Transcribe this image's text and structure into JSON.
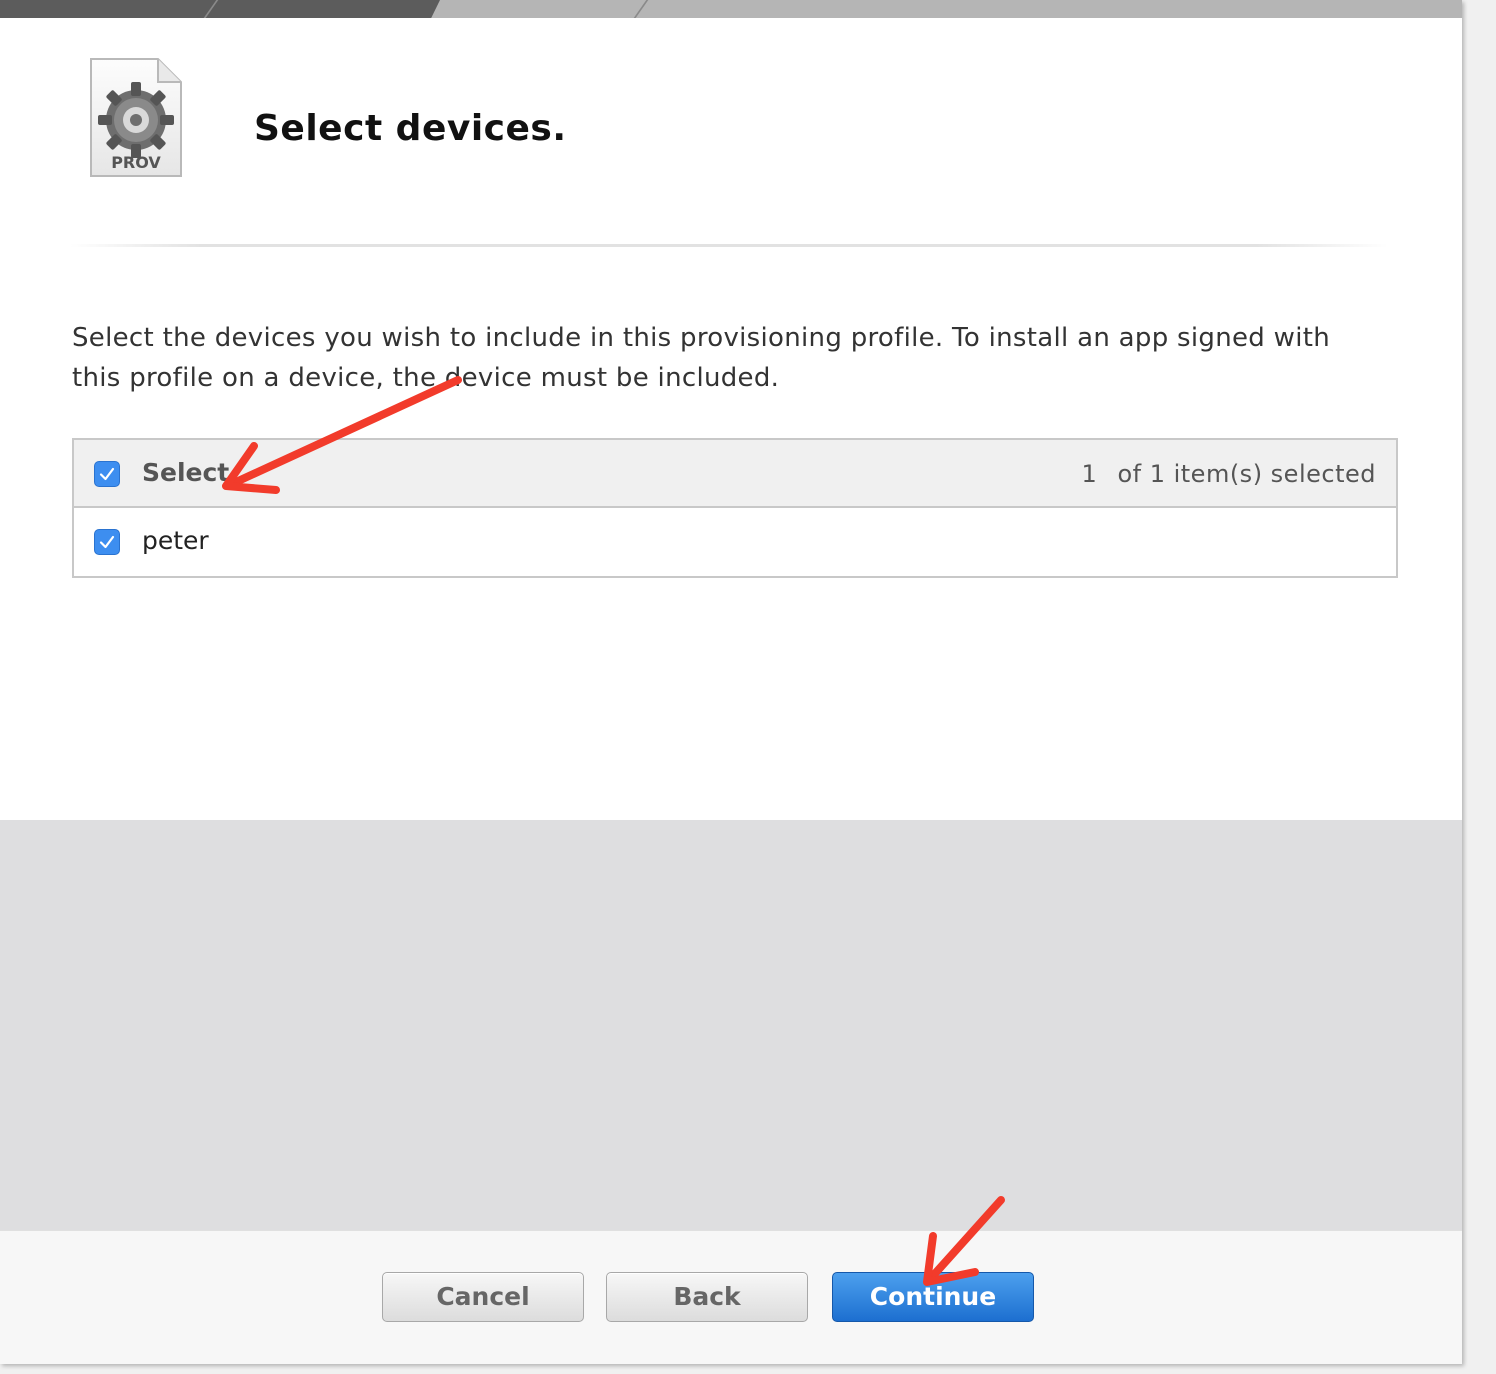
{
  "header": {
    "file_icon_label": "PROV",
    "title": "Select devices."
  },
  "description": "Select the devices you wish to include in this provisioning profile. To install an app signed with this profile on a device, the device must be included.",
  "table": {
    "header_label": "Select",
    "selected_count": "1",
    "selected_suffix": "of 1 item(s) selected",
    "rows": [
      {
        "label": "peter",
        "checked": true
      }
    ]
  },
  "buttons": {
    "cancel": "Cancel",
    "back": "Back",
    "continue": "Continue"
  },
  "colors": {
    "accent": "#3d8ef0",
    "primary_button": "#1d6fd0",
    "annotation_arrow": "#f23b2b"
  },
  "icons": [
    "gear-icon",
    "checkbox-checked-icon",
    "annotation-arrow"
  ]
}
